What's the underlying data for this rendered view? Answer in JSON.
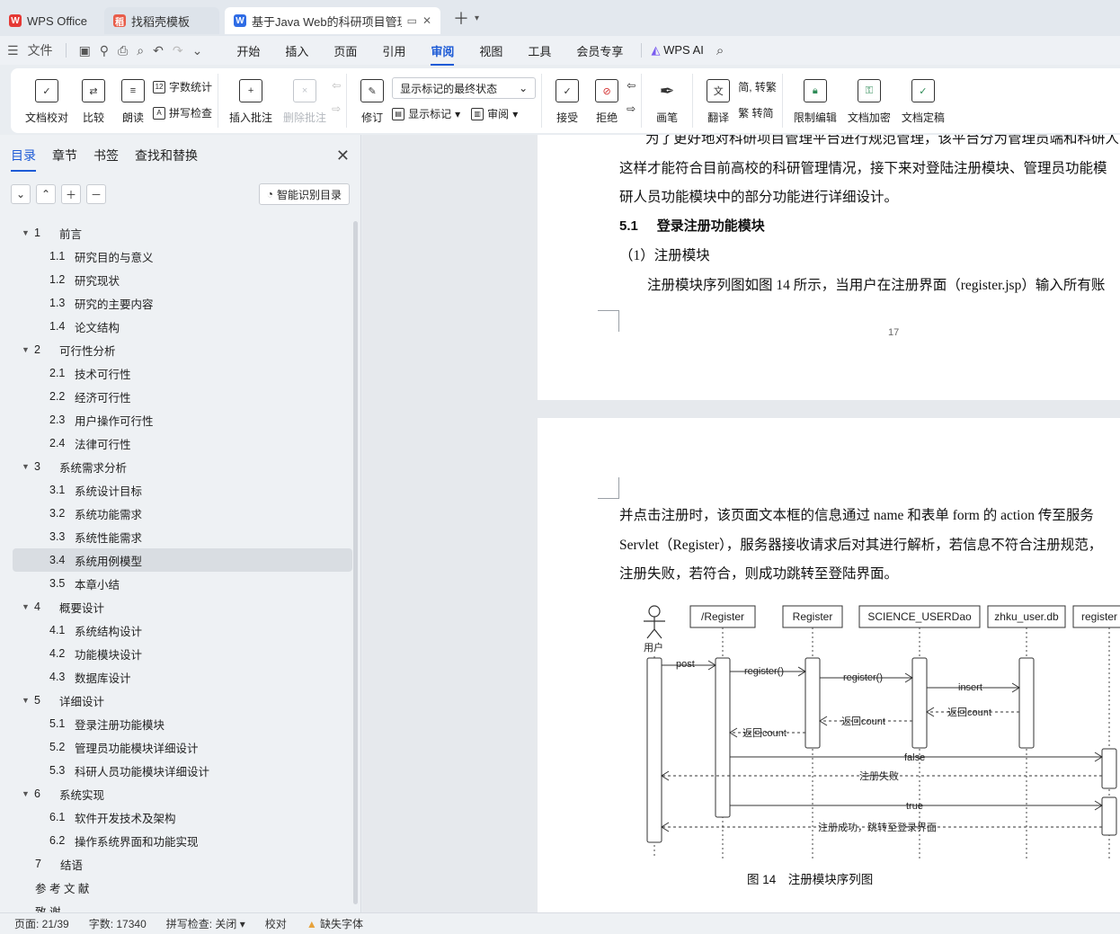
{
  "tabs": {
    "wps": "WPS Office",
    "daoke": "找稻壳模板",
    "doc": "基于Java Web的科研项目管理"
  },
  "menu": {
    "file": "文件",
    "items": [
      "开始",
      "插入",
      "页面",
      "引用",
      "审阅",
      "视图",
      "工具",
      "会员专享"
    ],
    "ai": "WPS AI"
  },
  "ribbon": {
    "doc_check": "文档校对",
    "compare": "比较",
    "read": "朗读",
    "word_count": "字数统计",
    "spell_check": "拼写检查",
    "insert_comment": "插入批注",
    "delete_comment": "删除批注",
    "revise": "修订",
    "markup_state": "显示标记的最终状态",
    "show_markup": "显示标记",
    "review": "审阅",
    "accept": "接受",
    "reject": "拒绝",
    "pen": "画笔",
    "translate": "翻译",
    "to_trad": "简, 转繁",
    "to_simp": "繁 转简",
    "restrict": "限制编辑",
    "encrypt": "文档加密",
    "finalize": "文档定稿"
  },
  "sidebar": {
    "tabs": [
      "目录",
      "章节",
      "书签",
      "查找和替换"
    ],
    "smart": "智能识别目录",
    "toc": [
      {
        "num": "1",
        "text": "前言",
        "level": 1
      },
      {
        "num": "1.1",
        "text": "研究目的与意义",
        "level": 2
      },
      {
        "num": "1.2",
        "text": "研究现状",
        "level": 2
      },
      {
        "num": "1.3",
        "text": "研究的主要内容",
        "level": 2
      },
      {
        "num": "1.4",
        "text": "论文结构",
        "level": 2
      },
      {
        "num": "2",
        "text": "可行性分析",
        "level": 1
      },
      {
        "num": "2.1",
        "text": "技术可行性",
        "level": 2
      },
      {
        "num": "2.2",
        "text": "经济可行性",
        "level": 2
      },
      {
        "num": "2.3",
        "text": "用户操作可行性",
        "level": 2
      },
      {
        "num": "2.4",
        "text": "法律可行性",
        "level": 2
      },
      {
        "num": "3",
        "text": "系统需求分析",
        "level": 1
      },
      {
        "num": "3.1",
        "text": "系统设计目标",
        "level": 2
      },
      {
        "num": "3.2",
        "text": "系统功能需求",
        "level": 2
      },
      {
        "num": "3.3",
        "text": "系统性能需求",
        "level": 2
      },
      {
        "num": "3.4",
        "text": "系统用例模型",
        "level": 2,
        "selected": true
      },
      {
        "num": "3.5",
        "text": "本章小结",
        "level": 2
      },
      {
        "num": "4",
        "text": "概要设计",
        "level": 1
      },
      {
        "num": "4.1",
        "text": "系统结构设计",
        "level": 2
      },
      {
        "num": "4.2",
        "text": "功能模块设计",
        "level": 2
      },
      {
        "num": "4.3",
        "text": "数据库设计",
        "level": 2
      },
      {
        "num": "5",
        "text": "详细设计",
        "level": 1
      },
      {
        "num": "5.1",
        "text": "登录注册功能模块",
        "level": 2
      },
      {
        "num": "5.2",
        "text": "管理员功能模块详细设计",
        "level": 2
      },
      {
        "num": "5.3",
        "text": "科研人员功能模块详细设计",
        "level": 2
      },
      {
        "num": "6",
        "text": "系统实现",
        "level": 1
      },
      {
        "num": "6.1",
        "text": "软件开发技术及架构",
        "level": 2
      },
      {
        "num": "6.2",
        "text": "操作系统界面和功能实现",
        "level": 2
      },
      {
        "num": "7",
        "text": "结语",
        "level": 0
      },
      {
        "num": "",
        "text": "参 考 文 献",
        "level": 0
      },
      {
        "num": "",
        "text": "致 谢",
        "level": 0
      }
    ]
  },
  "page1": {
    "line0": "为了更好地对科研项目管理平台进行规范管理，该平台分为管理员端和科研人",
    "line1": "这样才能符合目前高校的科研管理情况，接下来对登陆注册模块、管理员功能模",
    "line2": "研人员功能模块中的部分功能进行详细设计。",
    "heading_num": "5.1",
    "heading_text": "登录注册功能模块",
    "sub": "（1）注册模块",
    "line3": "注册模块序列图如图 14 所示，当用户在注册界面（register.jsp）输入所有账",
    "page_number": "17"
  },
  "page2": {
    "line0": "并点击注册时，该页面文本框的信息通过 name 和表单 form 的 action 传至服务",
    "line1": "Servlet（Register），服务器接收请求后对其进行解析，若信息不符合注册规范，",
    "line2": "注册失败，若符合，则成功跳转至登陆界面。",
    "caption": "图 14　注册模块序列图"
  },
  "diagram": {
    "actor": "用户",
    "lifelines": [
      "/Register",
      "Register",
      "SCIENCE_USERDao",
      "zhku_user.db",
      "register"
    ],
    "messages": [
      "post",
      "register()",
      "register()",
      "insert",
      "返回count",
      "返回count",
      "返回count",
      "false",
      "注册失败",
      "true",
      "注册成功，跳转至登录界面"
    ]
  },
  "status": {
    "page": "页面: 21/39",
    "words": "字数: 17340",
    "spell": "拼写检查: 关闭",
    "proof": "校对",
    "font": "缺失字体"
  }
}
